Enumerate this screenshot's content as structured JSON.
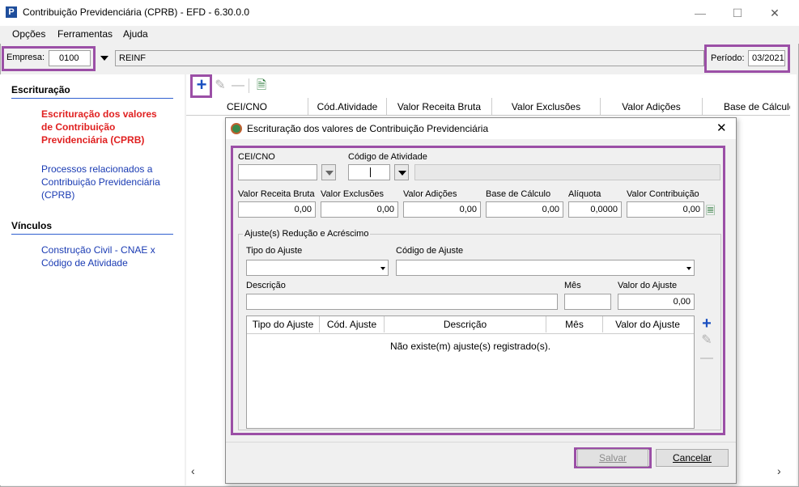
{
  "window": {
    "title": "Contribuição Previdenciária (CPRB) - EFD - 6.30.0.0",
    "icon_letter": "P"
  },
  "menu": {
    "items": [
      "Opções",
      "Ferramentas",
      "Ajuda"
    ]
  },
  "toolbar": {
    "empresa_label": "Empresa:",
    "empresa_value": "0100",
    "empresa_name": "REINF",
    "periodo_label": "Período:",
    "periodo_value": "03/2021"
  },
  "sidebar": {
    "section1": "Escrituração",
    "link1": "Escrituração dos valores de Contribuição Previdenciária (CPRB)",
    "link2": "Processos relacionados a Contribuição Previdenciária (CPRB)",
    "section2": "Vínculos",
    "link3": "Construção Civil - CNAE x Código de Atividade"
  },
  "grid": {
    "columns": [
      "CEI/CNO",
      "Cód.Atividade",
      "Valor Receita Bruta",
      "Valor Exclusões",
      "Valor Adições",
      "Base de Cálculo"
    ]
  },
  "dialog": {
    "title": "Escrituração dos valores de Contribuição Previdenciária",
    "cei_label": "CEI/CNO",
    "cod_atividade_label": "Código de Atividade",
    "receita_label": "Valor Receita Bruta",
    "receita_value": "0,00",
    "exclusoes_label": "Valor Exclusões",
    "exclusoes_value": "0,00",
    "adicoes_label": "Valor Adições",
    "adicoes_value": "0,00",
    "base_label": "Base de Cálculo",
    "base_value": "0,00",
    "aliquota_label": "Alíquota",
    "aliquota_value": "0,0000",
    "contribuicao_label": "Valor Contribuição",
    "contribuicao_value": "0,00",
    "group_title": "Ajuste(s) Redução e Acréscimo",
    "tipo_ajuste_label": "Tipo do Ajuste",
    "codigo_ajuste_label": "Código de Ajuste",
    "descricao_label": "Descrição",
    "mes_label": "Mês",
    "valor_ajuste_label": "Valor do Ajuste",
    "valor_ajuste_value": "0,00",
    "ajuste_columns": [
      "Tipo do Ajuste",
      "Cód. Ajuste",
      "Descrição",
      "Mês",
      "Valor do Ajuste"
    ],
    "empty_message": "Não existe(m) ajuste(s) registrado(s).",
    "save_label": "Salvar",
    "cancel_label": "Cancelar"
  },
  "colors": {
    "highlight": "#9b4fa6",
    "link": "#1a3bb3",
    "active_link": "#e02020",
    "plus_icon": "#1a4fc0"
  }
}
